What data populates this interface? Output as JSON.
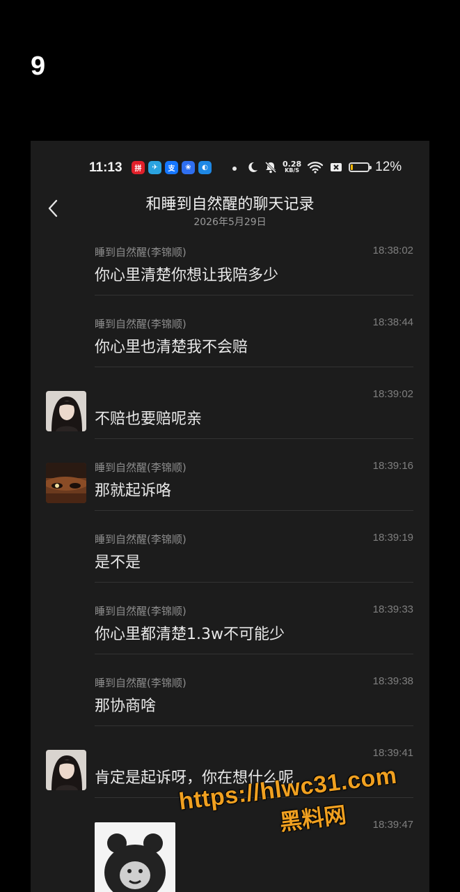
{
  "page_number": "9",
  "status_bar": {
    "time": "11:13",
    "app_icons": [
      {
        "name": "shopping-app-icon",
        "color": "#e0202a",
        "glyph": "拼"
      },
      {
        "name": "telegram-icon",
        "color": "#2aa3e0",
        "glyph": "✈"
      },
      {
        "name": "alipay-icon",
        "color": "#1677ff",
        "glyph": "支"
      },
      {
        "name": "baidu-icon",
        "color": "#2f6ff0",
        "glyph": "❀"
      },
      {
        "name": "browser-app-icon",
        "color": "#1e88e5",
        "glyph": "◐"
      }
    ],
    "net_speed_value": "0.28",
    "net_speed_unit": "KB/S",
    "battery_level": 0.12,
    "battery_percent": "12%"
  },
  "header": {
    "title": "和睡到自然醒的聊天记录",
    "date": "2026年5月29日"
  },
  "messages": [
    {
      "sender": "睡到自然醒(李锦顺)",
      "time": "18:38:02",
      "text": "你心里清楚你想让我陪多少",
      "avatar": null
    },
    {
      "sender": "睡到自然醒(李锦顺)",
      "time": "18:38:44",
      "text": "你心里也清楚我不会赔",
      "avatar": null
    },
    {
      "sender": "",
      "time": "18:39:02",
      "text": "不赔也要赔呢亲",
      "avatar": "woman-avatar"
    },
    {
      "sender": "睡到自然醒(李锦顺)",
      "time": "18:39:16",
      "text": "那就起诉咯",
      "avatar": "man-eye-avatar"
    },
    {
      "sender": "睡到自然醒(李锦顺)",
      "time": "18:39:19",
      "text": "是不是",
      "avatar": null
    },
    {
      "sender": "睡到自然醒(李锦顺)",
      "time": "18:39:33",
      "text": "你心里都清楚1.3w不可能少",
      "avatar": null
    },
    {
      "sender": "睡到自然醒(李锦顺)",
      "time": "18:39:38",
      "text": "那协商啥",
      "avatar": null
    },
    {
      "sender": "",
      "time": "18:39:41",
      "text": "肯定是起诉呀，你在想什么呢",
      "avatar": "woman-avatar"
    },
    {
      "sender": "",
      "time": "18:39:47",
      "text": "",
      "avatar": null,
      "sticker": "bear-sticker"
    }
  ],
  "watermark": {
    "url": "https://hlwc31.com",
    "name": "黑料网"
  }
}
